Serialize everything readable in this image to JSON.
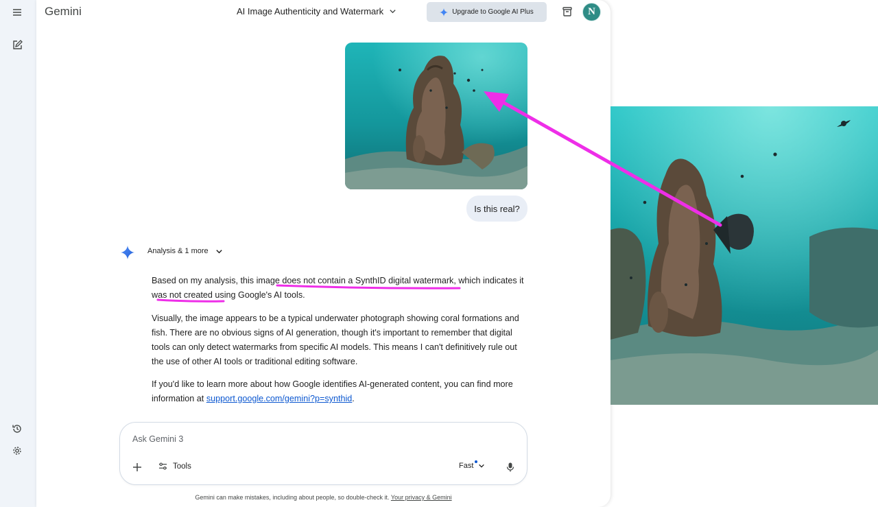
{
  "sidebar": {
    "menu_icon": "menu-icon",
    "new_chat_icon": "edit-icon",
    "activity_icon": "history-icon",
    "settings_icon": "gear-icon"
  },
  "header": {
    "app_title": "Gemini",
    "conversation_title": "AI Image Authenticity and Watermark",
    "upgrade_label": "Upgrade to Google AI Plus",
    "avatar_letter": "N"
  },
  "user_message": {
    "text": "Is this real?"
  },
  "response": {
    "chip_label": "Analysis & 1 more",
    "p1_a": "Based on my analysis, this image ",
    "p1_b": "does not contain a SynthID digital watermark",
    "p1_c": ", which indicates it ",
    "p1_d": "was not created",
    "p1_e": " using Google's AI tools.",
    "p2": "Visually, the image appears to be a typical underwater photograph showing coral formations and fish. There are no obvious signs of AI generation, though it's important to remember that digital tools can only detect watermarks from specific AI models. This means I can't definitively rule out the use of other AI tools or traditional editing software.",
    "p3_a": "If you'd like to learn more about how Google identifies AI-generated content, you can find more information at ",
    "p3_link": "support.google.com/gemini?p=synthid",
    "p3_b": "."
  },
  "input": {
    "placeholder": "Ask Gemini 3",
    "value": "",
    "tools_label": "Tools",
    "mode_label": "Fast"
  },
  "footer": {
    "disclaimer": "Gemini can make mistakes, including about people, so double-check it. ",
    "privacy_link": "Your privacy & Gemini"
  },
  "colors": {
    "rail_bg": "#f0f4f9",
    "accent": "#0b57d0",
    "annotation": "#ee2ee8",
    "bubble_bg": "#e9eef6",
    "upgrade_bg": "#dde3ea"
  }
}
